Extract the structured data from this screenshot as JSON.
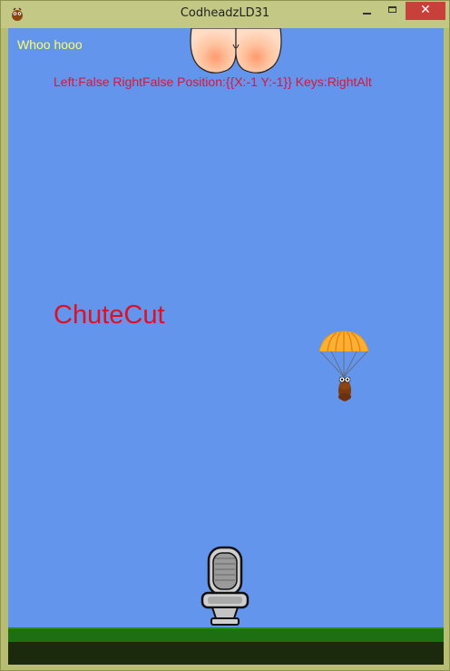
{
  "window": {
    "title": "CodheadzLD31",
    "app_icon": "app-bug-icon",
    "controls": {
      "minimize": "minimize-icon",
      "maximize": "maximize-icon",
      "close": "✕"
    }
  },
  "game": {
    "status_text": "Whoo hooo",
    "debug_text": "Left:False RightFalse Position:{{X:-1 Y:-1}} Keys:RightAlt",
    "action_text": "ChuteCut",
    "colors": {
      "sky": "#6495ed",
      "status": "#ffff66",
      "debug": "#dc143c",
      "action": "#e01020",
      "grass": "#1e6e12",
      "dirt": "#1b2a0d"
    },
    "sprites": {
      "top": "butt-sprite",
      "player": "parachuting-poop-sprite",
      "target": "toilet-sprite",
      "ground": "grass-ground"
    }
  }
}
